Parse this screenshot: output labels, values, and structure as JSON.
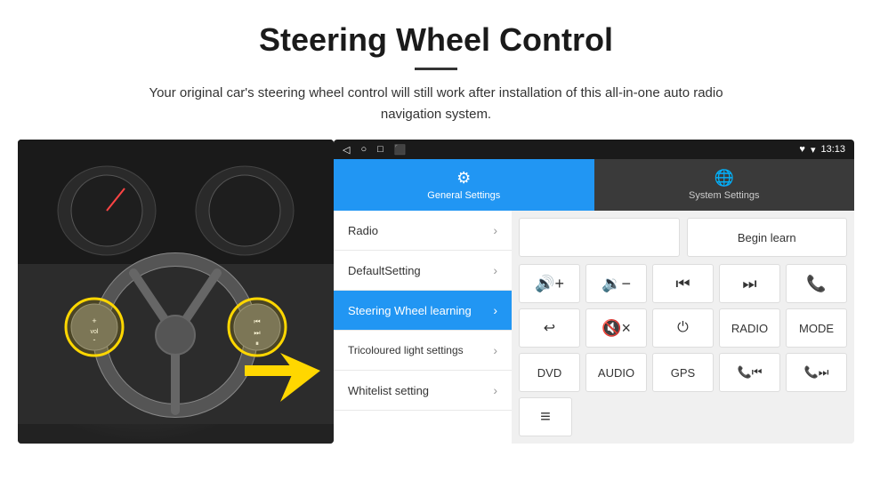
{
  "header": {
    "title": "Steering Wheel Control",
    "subtitle": "Your original car's steering wheel control will still work after installation of this all-in-one auto radio navigation system."
  },
  "status_bar": {
    "back_icon": "◁",
    "home_icon": "○",
    "recent_icon": "□",
    "screenshot_icon": "⬛",
    "wifi_icon": "▾",
    "signal_icon": "▾",
    "time": "13:13"
  },
  "tabs": [
    {
      "id": "general",
      "label": "General Settings",
      "icon": "⚙",
      "active": true
    },
    {
      "id": "system",
      "label": "System Settings",
      "icon": "🌐",
      "active": false
    }
  ],
  "menu_items": [
    {
      "id": "radio",
      "label": "Radio",
      "active": false
    },
    {
      "id": "default",
      "label": "DefaultSetting",
      "active": false
    },
    {
      "id": "steering",
      "label": "Steering Wheel learning",
      "active": true
    },
    {
      "id": "tricoloured",
      "label": "Tricoloured light settings",
      "active": false
    },
    {
      "id": "whitelist",
      "label": "Whitelist setting",
      "active": false
    }
  ],
  "controls": {
    "begin_learn": "Begin learn",
    "row1": [
      {
        "id": "vol_up",
        "label": "🔊+",
        "type": "icon"
      },
      {
        "id": "vol_down",
        "label": "🔉-",
        "type": "icon"
      },
      {
        "id": "prev_track",
        "label": "⏮",
        "type": "icon"
      },
      {
        "id": "next_track",
        "label": "⏭",
        "type": "icon"
      },
      {
        "id": "phone",
        "label": "📞",
        "type": "icon"
      }
    ],
    "row2": [
      {
        "id": "hang_up",
        "label": "↩",
        "type": "icon"
      },
      {
        "id": "mute",
        "label": "🔇×",
        "type": "icon"
      },
      {
        "id": "power",
        "label": "⏻",
        "type": "icon"
      },
      {
        "id": "radio_btn",
        "label": "RADIO",
        "type": "text"
      },
      {
        "id": "mode_btn",
        "label": "MODE",
        "type": "text"
      }
    ],
    "row3": [
      {
        "id": "dvd_btn",
        "label": "DVD",
        "type": "text"
      },
      {
        "id": "audio_btn",
        "label": "AUDIO",
        "type": "text"
      },
      {
        "id": "gps_btn",
        "label": "GPS",
        "type": "text"
      },
      {
        "id": "tel_prev",
        "label": "📞⏮",
        "type": "icon"
      },
      {
        "id": "tel_next",
        "label": "📞⏭",
        "type": "icon"
      }
    ],
    "row4": [
      {
        "id": "list_icon",
        "label": "≡",
        "type": "icon"
      }
    ]
  }
}
